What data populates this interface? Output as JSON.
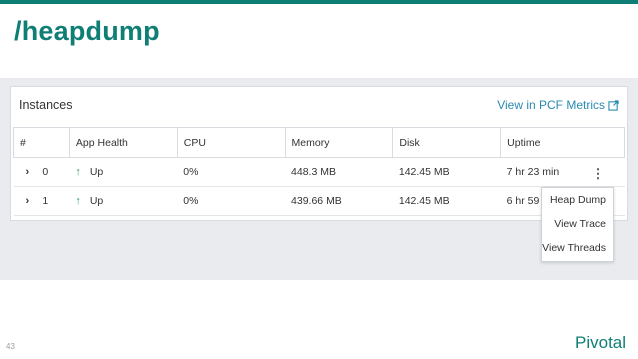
{
  "slide": {
    "title": "/heapdump",
    "page_number": "43",
    "logo_text": "Pivotal",
    "accent_color": "#0f7e75"
  },
  "panel": {
    "title": "Instances",
    "metrics_link": "View in PCF Metrics",
    "link_icon": "external-link-icon"
  },
  "table": {
    "headers": [
      "#",
      "App Health",
      "CPU",
      "Memory",
      "Disk",
      "Uptime"
    ],
    "rows": [
      {
        "expand": "›",
        "num": "0",
        "health_icon": "↑",
        "health": "Up",
        "cpu": "0%",
        "memory": "448.3 MB",
        "disk": "142.45 MB",
        "uptime": "7 hr 23 min"
      },
      {
        "expand": "›",
        "num": "1",
        "health_icon": "↑",
        "health": "Up",
        "cpu": "0%",
        "memory": "439.66 MB",
        "disk": "142.45 MB",
        "uptime": "6 hr 59"
      }
    ],
    "row_menu_icon": "⋮"
  },
  "menu": {
    "items": [
      "Heap Dump",
      "View Trace",
      "View Threads"
    ]
  }
}
